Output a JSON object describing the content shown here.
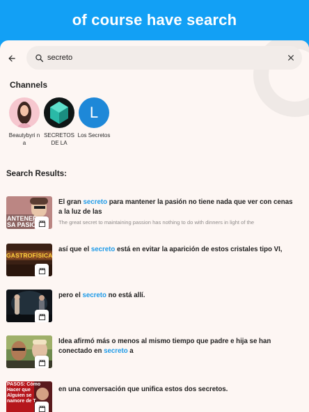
{
  "banner": {
    "title": "of course have search"
  },
  "search": {
    "value": "secreto"
  },
  "channels": {
    "title": "Channels",
    "items": [
      {
        "name": "Beautybyri na"
      },
      {
        "name": "SECRETOS DE LA"
      },
      {
        "name": "Los Secretos",
        "initial": "L"
      }
    ]
  },
  "results": {
    "title": "Search Results:",
    "items": [
      {
        "before": "El gran ",
        "highlight": "secreto",
        "after": " para mantener la pasión no tiene nada que ver con cenas a la luz de las",
        "translation": "The great secret to maintaining passion has nothing to do with dinners in light of the",
        "thumb_text": "ANTENER SA PASIÓ"
      },
      {
        "before": "así que el ",
        "highlight": "secreto",
        "after": " está en evitar la aparición de estos cristales tipo VI,",
        "translation": "",
        "thumb_text": "GASTROFÍSICA"
      },
      {
        "before": "pero el ",
        "highlight": "secreto",
        "after": " no está allí.",
        "translation": ""
      },
      {
        "before": "Idea afirmó más o menos al mismo tiempo que padre e hija se han conectado en ",
        "highlight": "secreto",
        "after": " a",
        "translation": ""
      },
      {
        "before": "en una conversación que unifica estos dos secretos.",
        "highlight": "",
        "after": "",
        "translation": "",
        "thumb_text": "PASOS: Cómo Hacer que Alguien se namore de T"
      }
    ]
  },
  "colors": {
    "accent": "#12a0f5",
    "highlight": "#1f9be8",
    "background": "#fdf6f3"
  }
}
